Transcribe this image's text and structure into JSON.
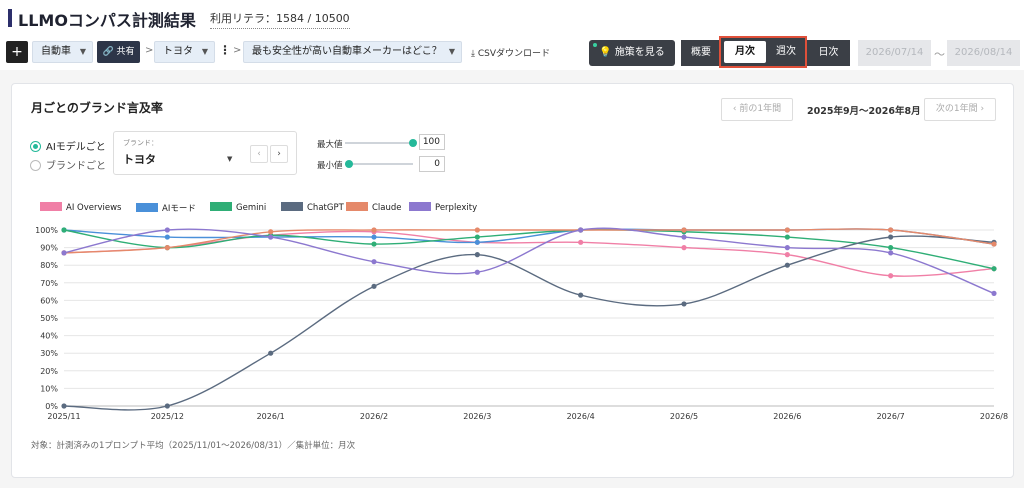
{
  "header": {
    "title": "LLMOコンパス計測結果",
    "usage": "利用リテラ：1584 / 10500"
  },
  "toolbar": {
    "plus": "+",
    "category": "自動車",
    "share": "共有",
    "brand": "トヨタ",
    "question": "最も安全性が高い自動車メーカーはどこ？",
    "csv": "CSVダウンロード",
    "measure": "施策を見る",
    "overview": "概要",
    "monthly": "月次",
    "weekly": "週次",
    "daily": "日次",
    "date_from": "2026/07/14",
    "tilde": "〜",
    "date_to": "2026/08/14",
    "sep": ">"
  },
  "card": {
    "title": "月ごとのブランド言及率",
    "prev": "‹ 前の1年間",
    "range": "2025年9月〜2026年8月",
    "next": "次の1年間 ›",
    "radio_model": "AIモデルごと",
    "radio_brand": "ブランドごと",
    "brand_label": "ブランド：",
    "brand_value": "トヨタ",
    "max_label": "最大値",
    "max_value": "100",
    "min_label": "最小値",
    "min_value": "0",
    "note": "対象：計測済みの1プロンプト平均（2025/11/01〜2026/08/31）／集計単位：月次"
  },
  "colors": {
    "AI Overviews": "#f07fa6",
    "AIモード": "#4a90d9",
    "Gemini": "#2fae76",
    "ChatGPT": "#5b6b80",
    "Claude": "#e5896a",
    "Perplexity": "#8c78cf"
  },
  "chart_data": {
    "type": "line",
    "x": [
      "2025/11",
      "2025/12",
      "2026/1",
      "2026/2",
      "2026/3",
      "2026/4",
      "2026/5",
      "2026/6",
      "2026/7",
      "2026/8"
    ],
    "ylim": [
      0,
      100
    ],
    "yticks": [
      "0%",
      "10%",
      "20%",
      "30%",
      "40%",
      "50%",
      "60%",
      "70%",
      "80%",
      "90%",
      "100%"
    ],
    "grid": true,
    "legend": "top-left",
    "series": [
      {
        "name": "AI Overviews",
        "values": [
          87,
          90,
          97,
          99,
          93,
          93,
          90,
          86,
          74,
          78
        ]
      },
      {
        "name": "AIモード",
        "values": [
          100,
          96,
          96,
          96,
          93,
          100,
          100,
          100,
          100,
          92
        ]
      },
      {
        "name": "Gemini",
        "values": [
          100,
          90,
          97,
          92,
          96,
          100,
          99,
          96,
          90,
          78
        ]
      },
      {
        "name": "ChatGPT",
        "values": [
          0,
          0,
          30,
          68,
          86,
          63,
          58,
          80,
          96,
          93
        ]
      },
      {
        "name": "Claude",
        "values": [
          87,
          90,
          99,
          100,
          100,
          100,
          100,
          100,
          100,
          92
        ]
      },
      {
        "name": "Perplexity",
        "values": [
          87,
          100,
          96,
          82,
          76,
          100,
          96,
          90,
          87,
          64
        ]
      }
    ]
  }
}
